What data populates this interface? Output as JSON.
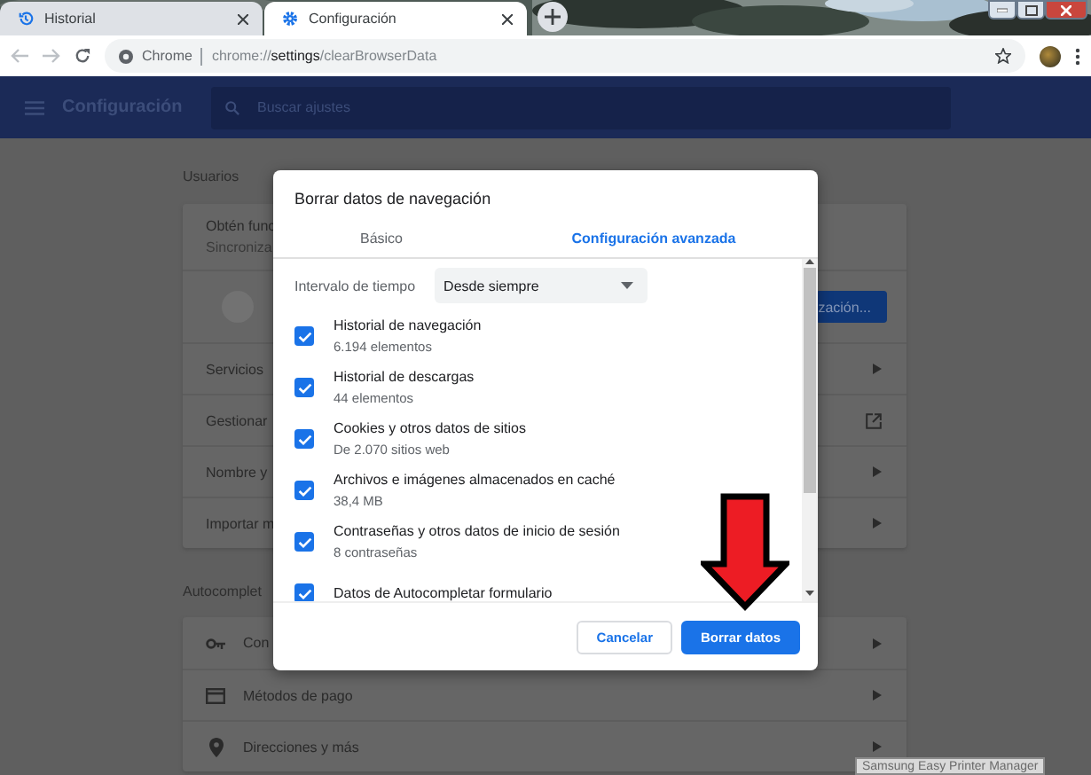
{
  "tabs": [
    {
      "title": "Historial",
      "selected": false
    },
    {
      "title": "Configuración",
      "selected": true
    }
  ],
  "address_bar": {
    "site_label": "Chrome",
    "url": "chrome://**settings**/clearBrowserData"
  },
  "header": {
    "title": "Configuración",
    "search_placeholder": "Buscar ajustes"
  },
  "sections": [
    {
      "title": "Usuarios",
      "rows": [
        {
          "kind": "sync",
          "title": "Obtén func",
          "subtitle": "Sincroniza"
        },
        {
          "kind": "account",
          "button": "zación..."
        },
        {
          "kind": "arrow",
          "label": "Servicios"
        },
        {
          "kind": "external",
          "label": "Gestionar"
        },
        {
          "kind": "arrow",
          "label": "Nombre y"
        },
        {
          "kind": "arrow",
          "label": "Importar m"
        }
      ]
    },
    {
      "title": "Autocomplet",
      "rows": [
        {
          "kind": "icon_arrow",
          "label": "Con"
        },
        {
          "kind": "icon_arrow",
          "label": "Métodos de pago"
        },
        {
          "kind": "icon_arrow",
          "label": "Direcciones y más"
        }
      ]
    }
  ],
  "dialog": {
    "title": "Borrar datos de navegación",
    "tabs": [
      {
        "label": "Básico",
        "selected": false
      },
      {
        "label": "Configuración avanzada",
        "selected": true
      }
    ],
    "time_range": {
      "label": "Intervalo de tiempo",
      "value": "Desde siempre"
    },
    "items": [
      {
        "title": "Historial de navegación",
        "subtitle": "6.194 elementos",
        "checked": true
      },
      {
        "title": "Historial de descargas",
        "subtitle": "44 elementos",
        "checked": true
      },
      {
        "title": "Cookies y otros datos de sitios",
        "subtitle": "De 2.070 sitios web",
        "checked": true
      },
      {
        "title": "Archivos e imágenes almacenados en caché",
        "subtitle": "38,4 MB",
        "checked": true
      },
      {
        "title": "Contraseñas y otros datos de inicio de sesión",
        "subtitle": "8 contraseñas",
        "checked": true
      },
      {
        "title": "Datos de Autocompletar formulario",
        "checked": true
      }
    ],
    "buttons": [
      {
        "label": "Cancelar",
        "kind": "secondary"
      },
      {
        "label": "Borrar datos",
        "kind": "primary"
      }
    ]
  },
  "tooltip": "Samsung Easy Printer Manager"
}
